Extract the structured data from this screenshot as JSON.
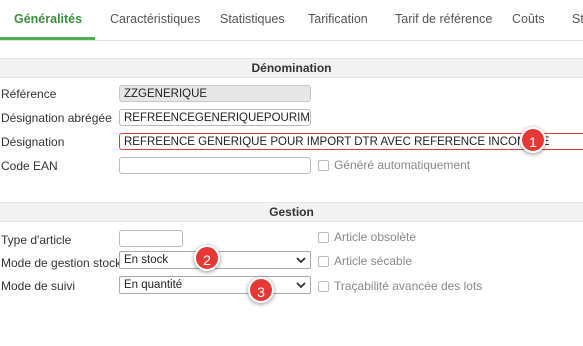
{
  "tabs": [
    {
      "label": "Généralités",
      "active": true
    },
    {
      "label": "Caractéristiques"
    },
    {
      "label": "Statistiques"
    },
    {
      "label": "Tarification"
    },
    {
      "label": "Tarif de référence"
    },
    {
      "label": "Coûts"
    },
    {
      "label": "St"
    }
  ],
  "denomination": {
    "title": "Dénomination",
    "reference_label": "Référence",
    "reference_value": "ZZGENERIQUE",
    "short_label": "Désignation abrégée",
    "short_value": "REFREENCEGENERIQUEPOURIMP",
    "designation_label": "Désignation",
    "designation_value": "REFREENCE GENERIQUE POUR IMPORT DTR AVEC REFERENCE INCONNUE",
    "ean_label": "Code EAN",
    "ean_value": "",
    "auto_label": "Généré automatiquement"
  },
  "gestion": {
    "title": "Gestion",
    "type_label": "Type d'article",
    "type_value": "",
    "obsolete_label": "Article obsolète",
    "stock_mode_label": "Mode de gestion stock",
    "stock_mode_value": "En stock",
    "secable_label": "Article sécable",
    "suivi_label": "Mode de suivi",
    "suivi_value": "En quantité",
    "tracabilite_label": "Traçabilité avancée des lots"
  },
  "badges": [
    "1",
    "2",
    "3"
  ],
  "colors": {
    "accent": "#4caf50",
    "badge": "#e53935",
    "error_border": "#e53935"
  }
}
